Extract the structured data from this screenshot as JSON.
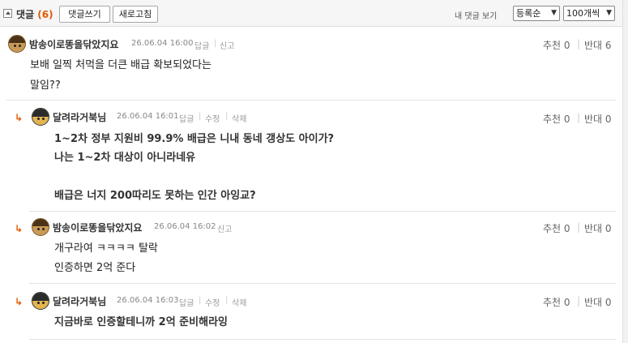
{
  "toolbar": {
    "title": "댓글",
    "count": "(6)",
    "write_label": "댓글쓰기",
    "refresh_label": "새로고침",
    "my_comments_label": "내 댓글 보기",
    "sort_value": "등록순",
    "per_page_value": "100개씩"
  },
  "comments": [
    {
      "nick": "밤송이로똥을닦았지요",
      "date": "26.06.04 16:00",
      "actions": [
        "답글",
        "신고"
      ],
      "recommend": "추천 0",
      "oppose": "반대 6",
      "lines": [
        "보배 일찍 처먹을 더큰 배급 확보되었다는",
        "말임??"
      ]
    },
    {
      "nick": "달려라거북님",
      "date": "26.06.04 16:01",
      "actions": [
        "답글",
        "수정",
        "삭제"
      ],
      "recommend": "추천 0",
      "oppose": "반대 0",
      "lines": [
        "1~2차 정부 지원비 99.9% 배급은 니내 동네 갱상도 아이가?",
        "나는 1~2차 대상이 아니라네유",
        "",
        "배급은 너지 200따리도 못하는 인간 아잉교?"
      ]
    },
    {
      "nick": "밤송이로똥을닦았지요",
      "date": "26.06.04 16:02",
      "actions": [
        "신고"
      ],
      "recommend": "추천 0",
      "oppose": "반대 0",
      "lines": [
        "개구라여 ㅋㅋㅋㅋ 탈락",
        "인증하면 2억 준다"
      ]
    },
    {
      "nick": "달려라거북님",
      "date": "26.06.04 16:03",
      "actions": [
        "답글",
        "수정",
        "삭제"
      ],
      "recommend": "추천 0",
      "oppose": "반대 0",
      "lines": [
        "지금바로 인증할테니까 2억 준비해라잉"
      ]
    }
  ],
  "reply_arrow": "↳",
  "icons": [
    "collapse-icon",
    "avatar-chestnut",
    "avatar-turtle",
    "reply-arrow-icon"
  ],
  "colors": {
    "accent": "#e05a00",
    "toolbar_bg": "#f6f6f6",
    "divider": "#e4e4e4"
  }
}
